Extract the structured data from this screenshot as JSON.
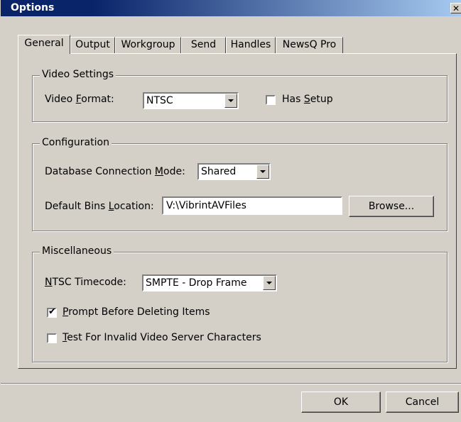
{
  "window": {
    "title": "Options",
    "close_glyph": "✕"
  },
  "tabs": [
    {
      "label": "General",
      "active": true
    },
    {
      "label": "Output"
    },
    {
      "label": "Workgroup"
    },
    {
      "label": "Send"
    },
    {
      "label": "Handles"
    },
    {
      "label": "NewsQ Pro"
    }
  ],
  "video_settings": {
    "legend": "Video Settings",
    "format_label_pre": "Video ",
    "format_label_accel": "F",
    "format_label_post": "ormat:",
    "format_value": "NTSC",
    "has_setup_label_pre": "Has ",
    "has_setup_label_accel": "S",
    "has_setup_label_post": "etup",
    "has_setup_checked": false
  },
  "configuration": {
    "legend": "Configuration",
    "db_mode_label_pre": "Database Connection ",
    "db_mode_label_accel": "M",
    "db_mode_label_post": "ode:",
    "db_mode_value": "Shared",
    "bins_label_pre": "Default Bins ",
    "bins_label_accel": "L",
    "bins_label_post": "ocation:",
    "bins_value": "V:\\VibrintAVFiles",
    "browse_label": "Browse..."
  },
  "miscellaneous": {
    "legend": "Miscellaneous",
    "timecode_label_accel": "N",
    "timecode_label_post": "TSC Timecode:",
    "timecode_value": "SMPTE - Drop Frame",
    "prompt_label_accel": "P",
    "prompt_label_post": "rompt Before Deleting Items",
    "prompt_checked": true,
    "test_label_accel": "T",
    "test_label_post": "est For Invalid Video Server Characters",
    "test_checked": false
  },
  "footer": {
    "ok_label": "OK",
    "cancel_label": "Cancel"
  },
  "icons": {
    "check": "✔"
  }
}
